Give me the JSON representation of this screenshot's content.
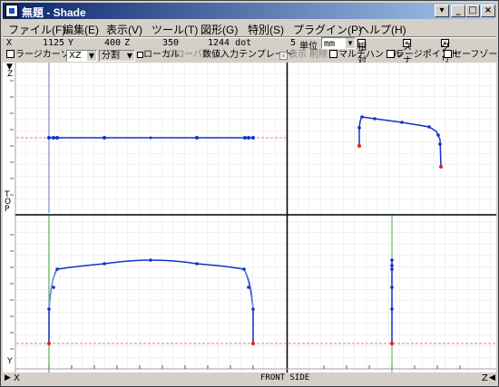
{
  "window": {
    "title": "無題 - Shade",
    "buttons": {
      "dropdown": "▾",
      "minimize": "_",
      "maximize": "□",
      "close": "×"
    }
  },
  "menu": [
    {
      "label": "ファイル(F)"
    },
    {
      "label": "編集(E)"
    },
    {
      "label": "表示(V)"
    },
    {
      "label": "ツール(T)"
    },
    {
      "label": "図形(G)"
    },
    {
      "label": "特別(S)"
    },
    {
      "label": "プラグイン(P)"
    },
    {
      "label": "ヘルプ(H)"
    }
  ],
  "coords": {
    "x_label": "X",
    "x_value": "1125",
    "y_label": "Y",
    "y_value": "400",
    "z_label": "Z",
    "z_value": "350",
    "dot_value": "1244 dot",
    "unit_num": "5",
    "unit_label": "単位",
    "unit_select": "mm",
    "relative_label": "相対座標",
    "snap_label": "スナップ",
    "grid_label": "グリッド"
  },
  "toolbar2": {
    "large_cursor": "ラージカーソル",
    "plane_select": "XZ",
    "split_select": "分割",
    "local": "ローカル",
    "global": "グローバル",
    "numeric_input": "数値入力",
    "template": "テンプレート",
    "show": "表示",
    "delete": "削除",
    "multi_handle": "マルチハンドル",
    "large_point": "ラージポイント",
    "safe_zone": "セーフゾーン"
  },
  "viewport": {
    "top_label": "TOP",
    "z_axis": "Z",
    "y_axis": "Y",
    "x_axis": "X",
    "front_side": "FRONT SIDE",
    "z_right": "Z"
  },
  "colors": {
    "curve": "#1530c8",
    "axis_red": "#e08080",
    "axis_blue": "#8080e0",
    "axis_green": "#40b040",
    "grid": "#e4e4e4"
  }
}
